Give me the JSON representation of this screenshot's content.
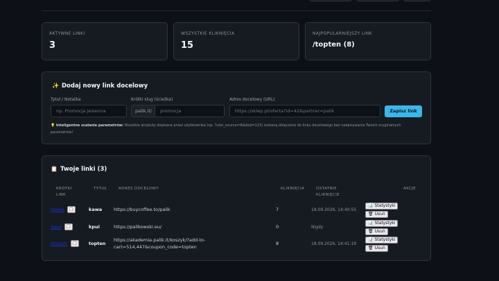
{
  "stats": [
    {
      "label": "AKTYWNE LINKI",
      "value": "3"
    },
    {
      "label": "WSZYSTKIE KLIKNIĘCIA",
      "value": "15"
    },
    {
      "label": "NAJPOPULARNIEJSZY LINK",
      "value": "/topten (8)"
    }
  ],
  "form": {
    "title": "Dodaj nowy link docelowy",
    "title_icon": "sparkles-icon",
    "note_label": "Tytuł / Notatka",
    "note_placeholder": "np. Promocja jesienna",
    "slug_label": "Krótki slug (ścieżka)",
    "slug_prefix": "palik.it/",
    "slug_placeholder": "promocja",
    "url_label": "Adres docelowy (URL)",
    "url_placeholder": "https://sklep.pl/oferta?id=42&partner=palik",
    "save_label": "Zapisz link",
    "hint_title": "Inteligentne scalanie parametrów:",
    "hint_text": " Wszelkie atrybuty dopisane przez użytkownika (np. ?utm_source=fb&kod=123) zostaną dołączone do linku docelowego bez nadpisywania Twoich oryginalnych parametrów!"
  },
  "links": {
    "title": "Twoje linki (3)",
    "title_icon": "clipboard-icon",
    "headers": {
      "short_link": "KRÓTKI LINK",
      "title": "TYTUŁ",
      "target": "ADRES DOCELOWY",
      "clicks": "KLIKNIĘCIA",
      "last_click": "OSTATNIE KLIKNIĘCIE",
      "actions": "AKCJE"
    },
    "stats_label": "Statystyki",
    "delete_label": "Usuń",
    "rows": [
      {
        "short": "/kawa",
        "title": "kawa",
        "target": "https://buycoffee.to/palik",
        "target2": "",
        "clicks": "7",
        "last": "18.09.2026, 14:40:55"
      },
      {
        "short": "/kpui",
        "title": "kpui",
        "target": "https://palikowski.eu/",
        "target2": "",
        "clicks": "0",
        "last": "Nigdy"
      },
      {
        "short": "/topten",
        "title": "topten",
        "target": "https://akademia.palik.it/koszyk/?add-to-",
        "target2": "cart=514,447&coupon_code=topten",
        "clicks": "8",
        "last": "18.09.2026, 14:41:19"
      }
    ]
  }
}
